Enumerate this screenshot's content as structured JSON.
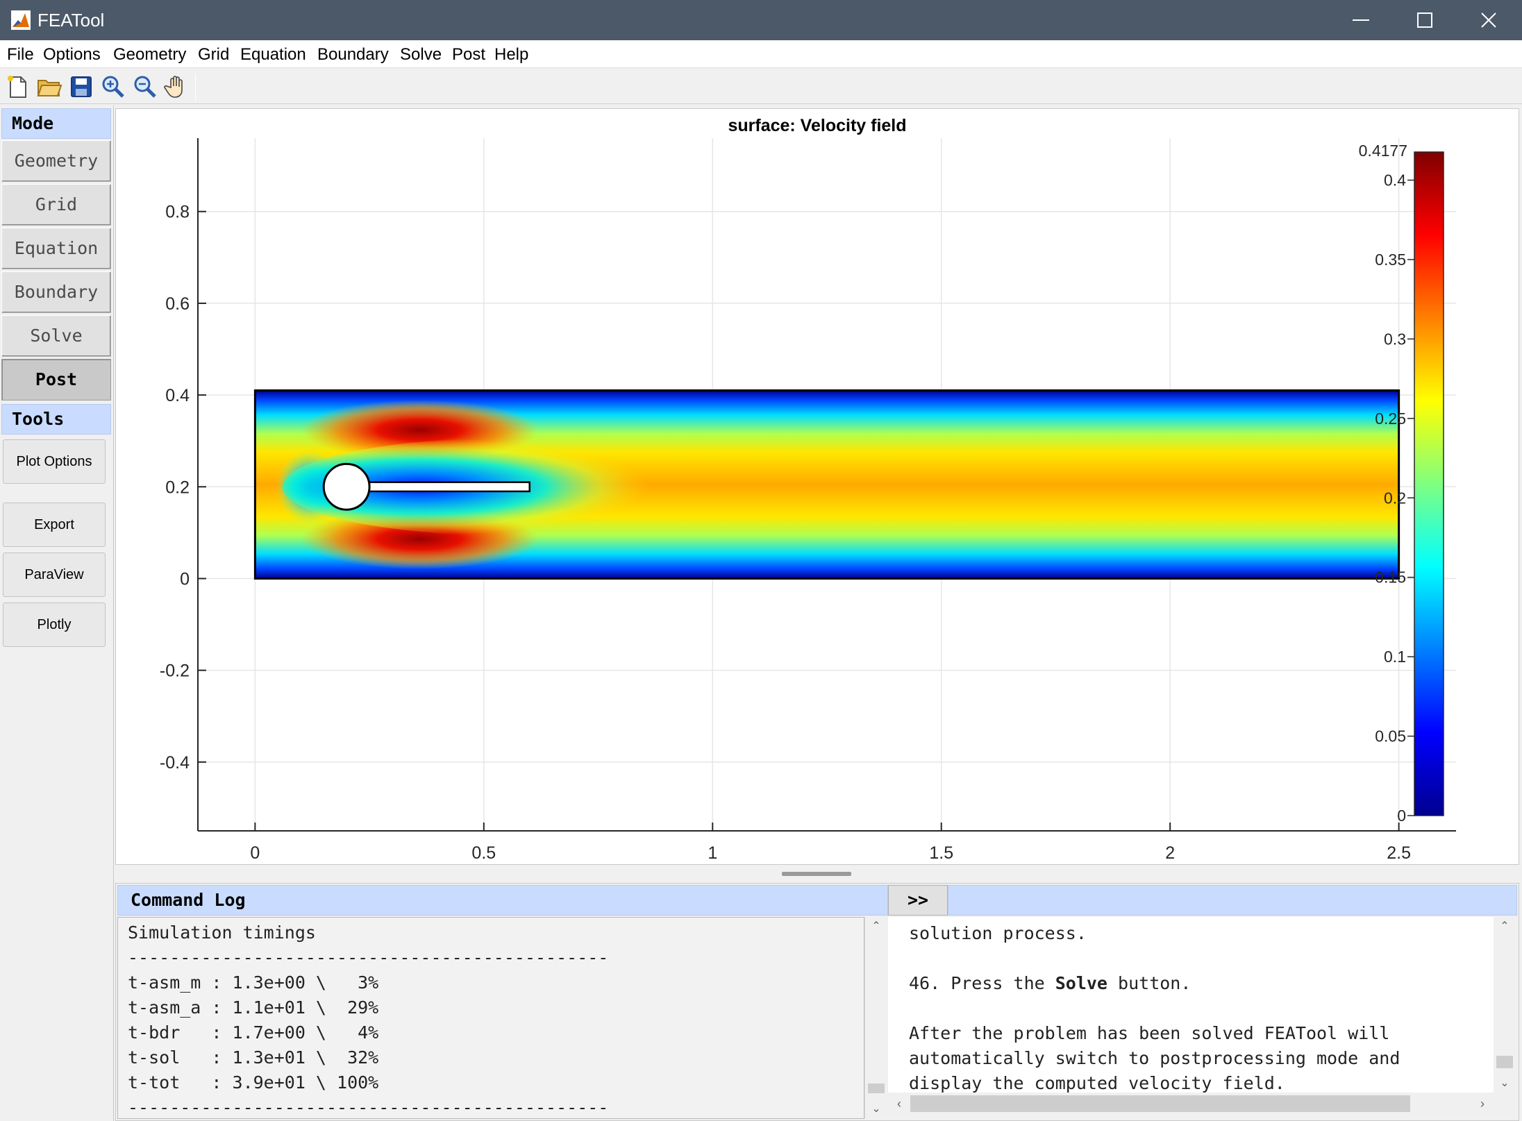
{
  "window": {
    "title": "FEATool",
    "minimize_icon": "minimize-icon",
    "maximize_icon": "maximize-icon",
    "close_icon": "close-icon"
  },
  "menu": [
    "File",
    "Options",
    "Geometry",
    "Grid",
    "Equation",
    "Boundary",
    "Solve",
    "Post",
    "Help"
  ],
  "toolbar": [
    "new-file-icon",
    "open-folder-icon",
    "save-icon",
    "zoom-in-icon",
    "zoom-out-icon",
    "pan-hand-icon"
  ],
  "sidebar": {
    "mode_title": "Mode",
    "modes": [
      "Geometry",
      "Grid",
      "Equation",
      "Boundary",
      "Solve",
      "Post"
    ],
    "active_mode": "Post",
    "tools_title": "Tools",
    "tools": [
      "Plot Options",
      "Export",
      "ParaView",
      "Plotly"
    ]
  },
  "chart_data": {
    "type": "heatmap",
    "title": "surface: Velocity field",
    "xlabel": "",
    "ylabel": "",
    "xlim": [
      -0.125,
      2.625
    ],
    "ylim": [
      -0.55,
      0.96
    ],
    "xticks": [
      0,
      0.5,
      1,
      1.5,
      2,
      2.5
    ],
    "xtick_labels": [
      "0",
      "0.5",
      "1",
      "1.5",
      "2",
      "2.5"
    ],
    "yticks": [
      -0.4,
      -0.2,
      0,
      0.2,
      0.4,
      0.6,
      0.8
    ],
    "ytick_labels": [
      "-0.4",
      "-0.2",
      "0",
      "0.2",
      "0.4",
      "0.6",
      "0.8"
    ],
    "grid": true,
    "domain": {
      "x": [
        0,
        2.5
      ],
      "y": [
        0,
        0.41
      ]
    },
    "cylinder": {
      "cx": 0.2,
      "cy": 0.2,
      "r": 0.05
    },
    "flag": {
      "x": [
        0.2,
        0.6
      ],
      "y": [
        0.19,
        0.21
      ]
    },
    "colorbar": {
      "min": 0,
      "max": 0.4177,
      "max_label": "0.4177",
      "ticks": [
        0,
        0.05,
        0.1,
        0.15,
        0.2,
        0.25,
        0.3,
        0.35,
        0.4
      ],
      "tick_labels": [
        "0",
        "0.05",
        "0.1",
        "0.15",
        "0.2",
        "0.25",
        "0.3",
        "0.35",
        "0.4"
      ],
      "colormap": "jet",
      "placement": "right"
    }
  },
  "command_log": {
    "title": "Command Log",
    "expand_label": ">>",
    "lines": [
      "Simulation timings",
      "----------------------------------------------",
      "t-asm_m : 1.3e+00 \\   3%",
      "t-asm_a : 1.1e+01 \\  29%",
      "t-bdr   : 1.7e+00 \\   4%",
      "t-sol   : 1.3e+01 \\  32%",
      "t-tot   : 3.9e+01 \\ 100%",
      "----------------------------------------------"
    ]
  },
  "help_panel": {
    "line1": "solution process.",
    "step_prefix": "46. Press the ",
    "step_bold": "Solve",
    "step_suffix": " button.",
    "para": [
      "After the problem has been solved FEATool will",
      "automatically switch to postprocessing mode and",
      "display the computed velocity field."
    ]
  },
  "colors": {
    "titlebar": "#4c5968",
    "section_header": "#c9dcff",
    "panel_bg": "#f0f0f0"
  }
}
